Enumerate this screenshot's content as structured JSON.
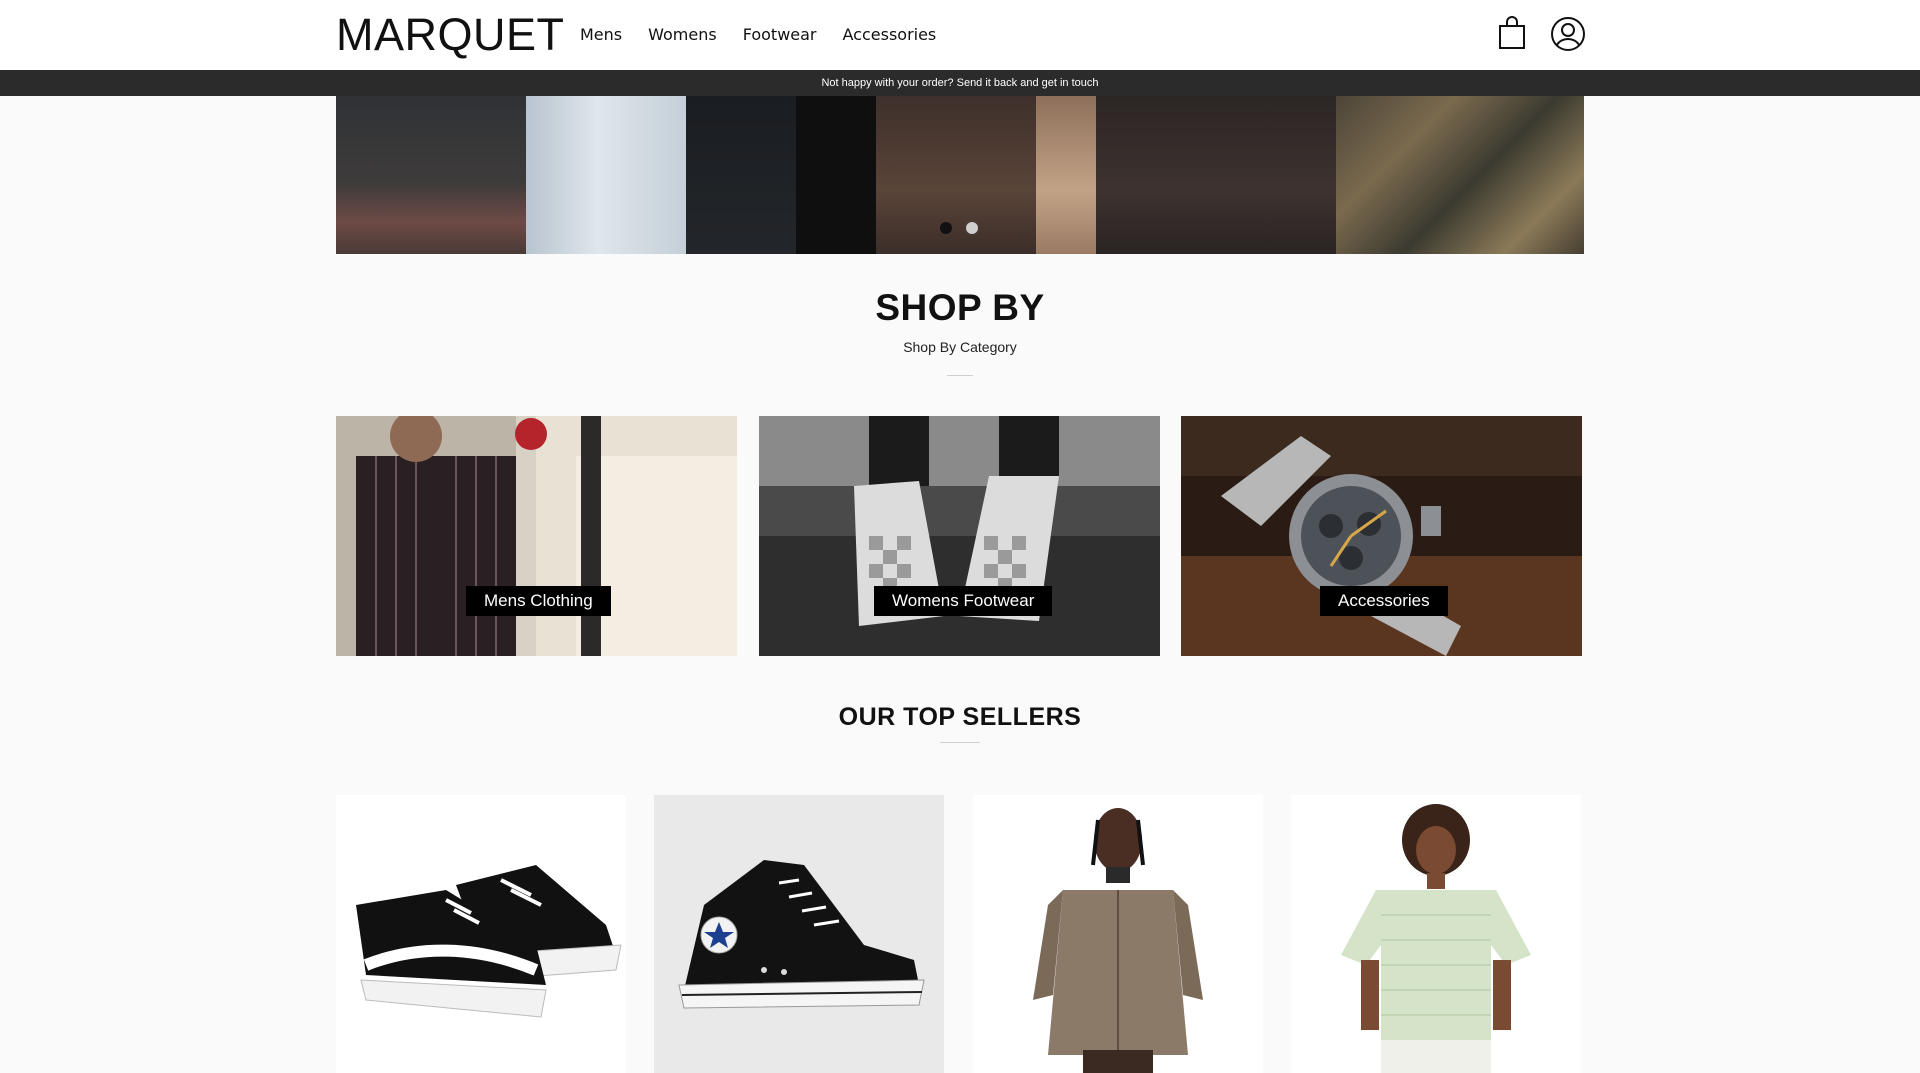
{
  "header": {
    "logo": "MARQUET",
    "nav": [
      "Mens",
      "Womens",
      "Footwear",
      "Accessories"
    ],
    "icons": {
      "cart": "shopping-bag-icon",
      "account": "user-account-icon"
    }
  },
  "announcement": "Not happy with your order? Send it back and get in touch",
  "hero": {
    "slides": 2,
    "active_slide": 1
  },
  "shop_by": {
    "title": "SHOP BY",
    "subtitle": "Shop By Category",
    "categories": [
      "Mens Clothing",
      "Womens Footwear",
      "Accessories"
    ]
  },
  "top_sellers": {
    "title": "OUR TOP SELLERS",
    "products": [
      "black-low-top-sneaker",
      "black-high-top-sneaker",
      "tan-work-jacket",
      "mint-striped-tee"
    ]
  },
  "colors": {
    "header_bg": "#ffffff",
    "announce_bg": "#2b2b2b",
    "page_bg": "#fafafa",
    "label_bg": "#000000"
  }
}
